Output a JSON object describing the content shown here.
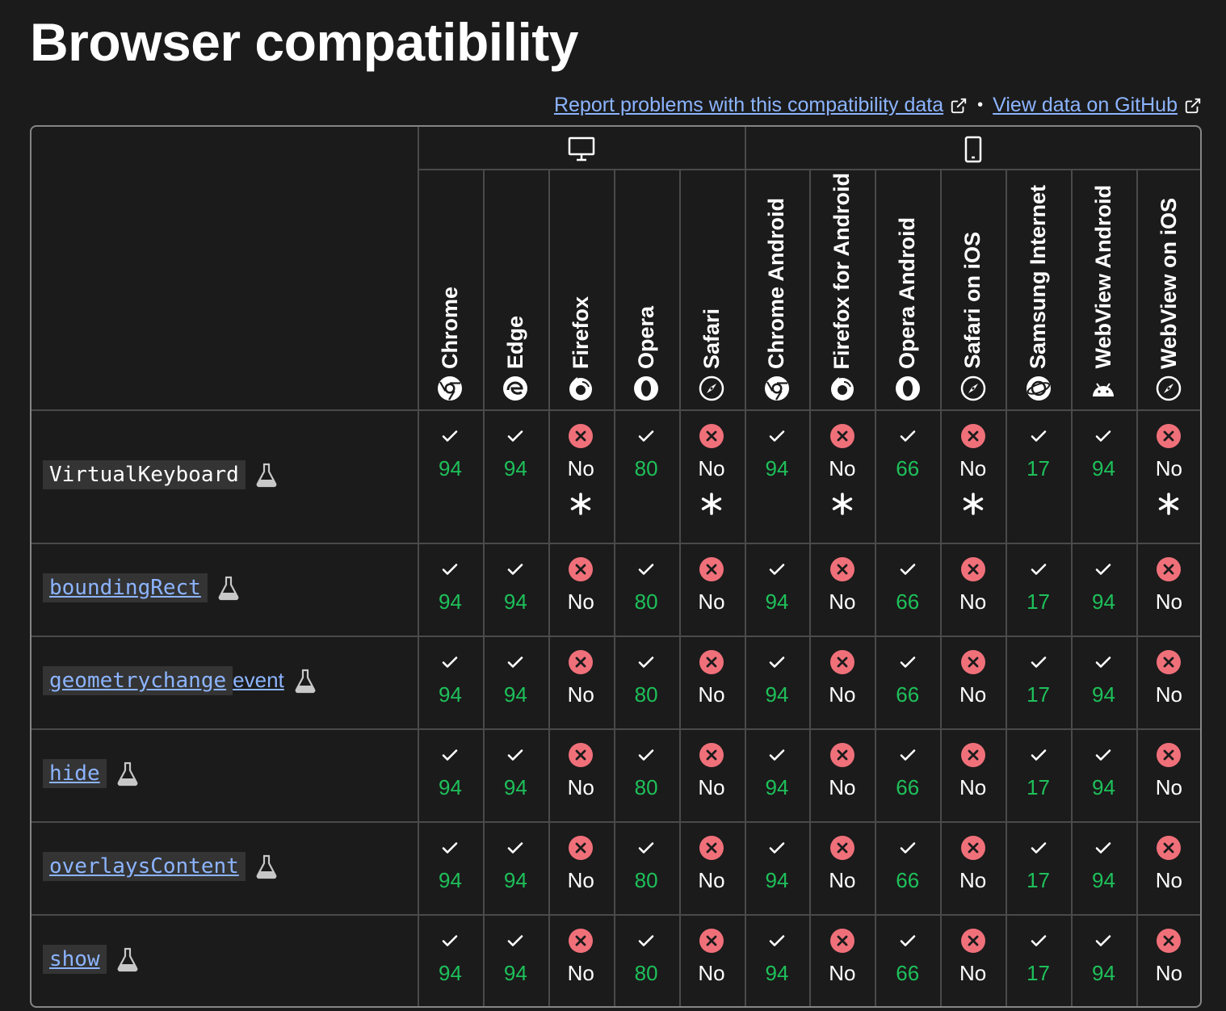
{
  "title": "Browser compatibility",
  "links": {
    "report": "Report problems with this compatibility data",
    "separator": "•",
    "github": "View data on GitHub"
  },
  "platforms": [
    "desktop-icon",
    "mobile-icon"
  ],
  "browsers": [
    {
      "name": "Chrome",
      "icon": "chrome-icon"
    },
    {
      "name": "Edge",
      "icon": "edge-icon"
    },
    {
      "name": "Firefox",
      "icon": "firefox-icon"
    },
    {
      "name": "Opera",
      "icon": "opera-icon"
    },
    {
      "name": "Safari",
      "icon": "safari-icon"
    },
    {
      "name": "Chrome Android",
      "icon": "chrome-icon"
    },
    {
      "name": "Firefox for Android",
      "icon": "firefox-icon"
    },
    {
      "name": "Opera Android",
      "icon": "opera-icon"
    },
    {
      "name": "Safari on iOS",
      "icon": "safari-icon"
    },
    {
      "name": "Samsung Internet",
      "icon": "samsung-internet-icon"
    },
    {
      "name": "WebView Android",
      "icon": "android-icon"
    },
    {
      "name": "WebView on iOS",
      "icon": "safari-icon"
    }
  ],
  "features": [
    {
      "name": "VirtualKeyboard",
      "is_link": false,
      "suffix": "",
      "experimental": true
    },
    {
      "name": "boundingRect",
      "is_link": true,
      "suffix": "",
      "experimental": true
    },
    {
      "name": "geometrychange",
      "is_link": true,
      "suffix": " event",
      "experimental": true
    },
    {
      "name": "hide",
      "is_link": true,
      "suffix": "",
      "experimental": true
    },
    {
      "name": "overlaysContent",
      "is_link": true,
      "suffix": "",
      "experimental": true
    },
    {
      "name": "show",
      "is_link": true,
      "suffix": "",
      "experimental": true
    }
  ],
  "support": [
    [
      {
        "s": "yes",
        "v": "94"
      },
      {
        "s": "yes",
        "v": "94"
      },
      {
        "s": "no",
        "v": "No",
        "note": true
      },
      {
        "s": "yes",
        "v": "80"
      },
      {
        "s": "no",
        "v": "No",
        "note": true
      },
      {
        "s": "yes",
        "v": "94"
      },
      {
        "s": "no",
        "v": "No",
        "note": true
      },
      {
        "s": "yes",
        "v": "66"
      },
      {
        "s": "no",
        "v": "No",
        "note": true
      },
      {
        "s": "yes",
        "v": "17"
      },
      {
        "s": "yes",
        "v": "94"
      },
      {
        "s": "no",
        "v": "No",
        "note": true
      }
    ],
    [
      {
        "s": "yes",
        "v": "94"
      },
      {
        "s": "yes",
        "v": "94"
      },
      {
        "s": "no",
        "v": "No"
      },
      {
        "s": "yes",
        "v": "80"
      },
      {
        "s": "no",
        "v": "No"
      },
      {
        "s": "yes",
        "v": "94"
      },
      {
        "s": "no",
        "v": "No"
      },
      {
        "s": "yes",
        "v": "66"
      },
      {
        "s": "no",
        "v": "No"
      },
      {
        "s": "yes",
        "v": "17"
      },
      {
        "s": "yes",
        "v": "94"
      },
      {
        "s": "no",
        "v": "No"
      }
    ],
    [
      {
        "s": "yes",
        "v": "94"
      },
      {
        "s": "yes",
        "v": "94"
      },
      {
        "s": "no",
        "v": "No"
      },
      {
        "s": "yes",
        "v": "80"
      },
      {
        "s": "no",
        "v": "No"
      },
      {
        "s": "yes",
        "v": "94"
      },
      {
        "s": "no",
        "v": "No"
      },
      {
        "s": "yes",
        "v": "66"
      },
      {
        "s": "no",
        "v": "No"
      },
      {
        "s": "yes",
        "v": "17"
      },
      {
        "s": "yes",
        "v": "94"
      },
      {
        "s": "no",
        "v": "No"
      }
    ],
    [
      {
        "s": "yes",
        "v": "94"
      },
      {
        "s": "yes",
        "v": "94"
      },
      {
        "s": "no",
        "v": "No"
      },
      {
        "s": "yes",
        "v": "80"
      },
      {
        "s": "no",
        "v": "No"
      },
      {
        "s": "yes",
        "v": "94"
      },
      {
        "s": "no",
        "v": "No"
      },
      {
        "s": "yes",
        "v": "66"
      },
      {
        "s": "no",
        "v": "No"
      },
      {
        "s": "yes",
        "v": "17"
      },
      {
        "s": "yes",
        "v": "94"
      },
      {
        "s": "no",
        "v": "No"
      }
    ],
    [
      {
        "s": "yes",
        "v": "94"
      },
      {
        "s": "yes",
        "v": "94"
      },
      {
        "s": "no",
        "v": "No"
      },
      {
        "s": "yes",
        "v": "80"
      },
      {
        "s": "no",
        "v": "No"
      },
      {
        "s": "yes",
        "v": "94"
      },
      {
        "s": "no",
        "v": "No"
      },
      {
        "s": "yes",
        "v": "66"
      },
      {
        "s": "no",
        "v": "No"
      },
      {
        "s": "yes",
        "v": "17"
      },
      {
        "s": "yes",
        "v": "94"
      },
      {
        "s": "no",
        "v": "No"
      }
    ],
    [
      {
        "s": "yes",
        "v": "94"
      },
      {
        "s": "yes",
        "v": "94"
      },
      {
        "s": "no",
        "v": "No"
      },
      {
        "s": "yes",
        "v": "80"
      },
      {
        "s": "no",
        "v": "No"
      },
      {
        "s": "yes",
        "v": "94"
      },
      {
        "s": "no",
        "v": "No"
      },
      {
        "s": "yes",
        "v": "66"
      },
      {
        "s": "no",
        "v": "No"
      },
      {
        "s": "yes",
        "v": "17"
      },
      {
        "s": "yes",
        "v": "94"
      },
      {
        "s": "no",
        "v": "No"
      }
    ]
  ],
  "colors": {
    "background": "#1b1b1b",
    "link": "#8cb4ff",
    "supported": "#1ec05a",
    "unsupported": "#f0707a",
    "border": "#4a4a4a"
  }
}
